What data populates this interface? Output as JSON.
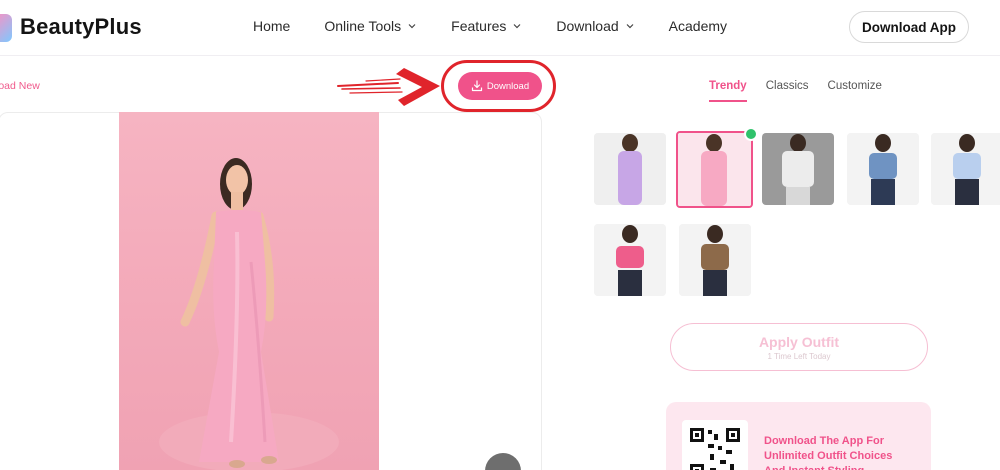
{
  "brand": {
    "name": "BeautyPlus"
  },
  "nav": {
    "items": [
      {
        "label": "Home",
        "dropdown": false
      },
      {
        "label": "Online Tools",
        "dropdown": true
      },
      {
        "label": "Features",
        "dropdown": true
      },
      {
        "label": "Download",
        "dropdown": true
      },
      {
        "label": "Academy",
        "dropdown": false
      }
    ],
    "download_app_label": "Download App"
  },
  "editor": {
    "upload_new_label": "load New",
    "download_label": "Download",
    "download_icon": "download-tray-icon",
    "annotation_color": "#e0242b"
  },
  "outfits": {
    "tabs": [
      {
        "label": "Trendy",
        "active": true
      },
      {
        "label": "Classics",
        "active": false
      },
      {
        "label": "Customize",
        "active": false
      }
    ],
    "selected_index": 1,
    "apply_label": "Apply Outfit",
    "apply_sub": "1 Time Left Today"
  },
  "promo": {
    "text": "Download The App For Unlimited Outfit Choices And Instant Styling"
  },
  "colors": {
    "accent": "#f0528a",
    "check": "#2fc26b"
  }
}
